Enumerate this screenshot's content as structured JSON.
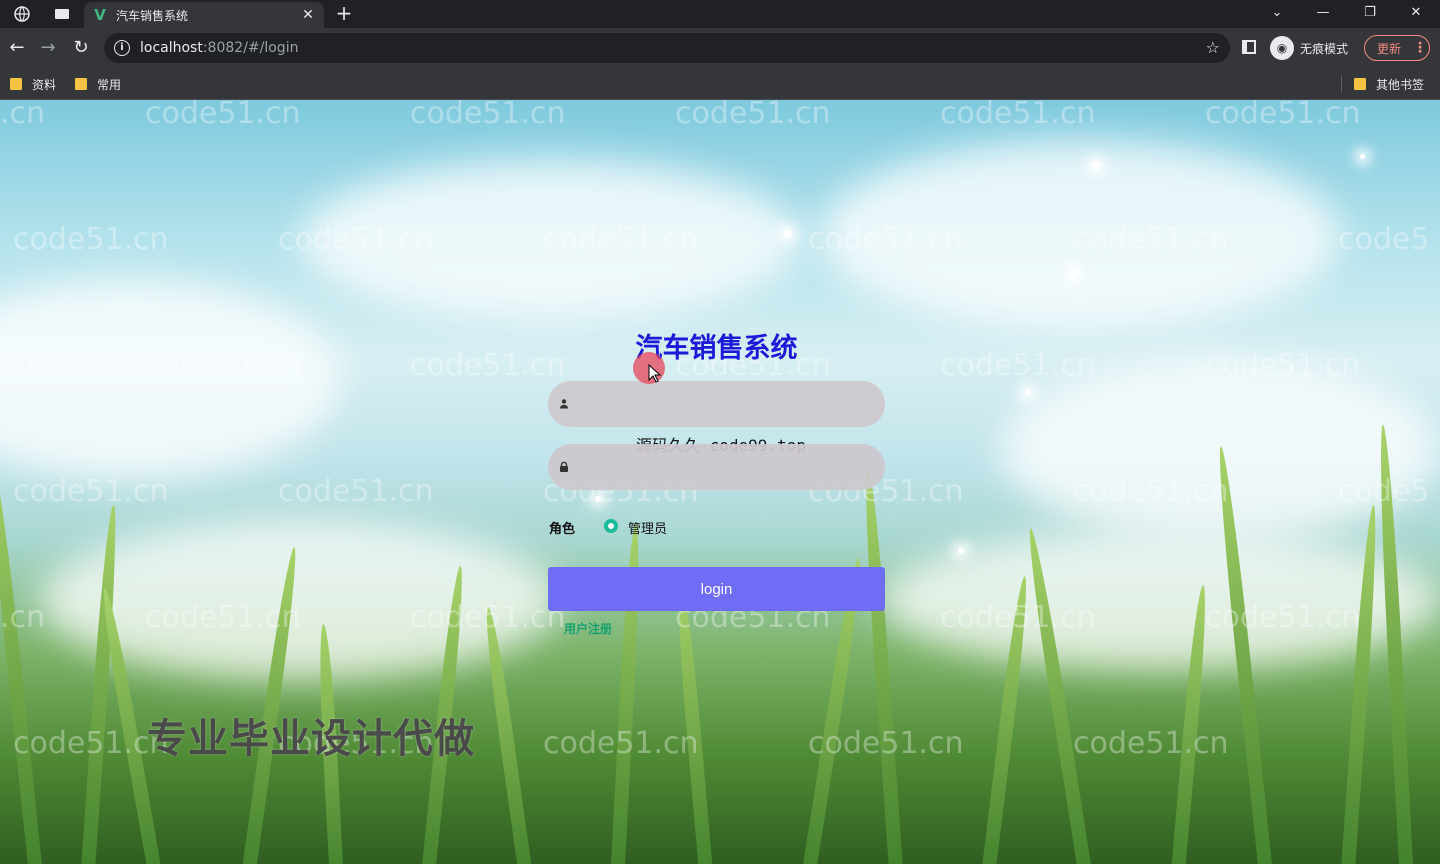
{
  "browser": {
    "tab_title": "汽车销售系统",
    "url_host": "localhost",
    "url_rest": ":8082/#/login",
    "incognito_label": "无痕模式",
    "update_label": "更新",
    "bookmarks": [
      "资料",
      "常用"
    ],
    "other_bookmarks": "其他书签"
  },
  "login": {
    "title": "汽车销售系统",
    "username_value": "",
    "password_value": "",
    "role_label": "角色",
    "role_option": "管理员",
    "login_button": "login",
    "register_link": "用户注册"
  },
  "overlay": {
    "source_watermark": "源码久久-code99.top",
    "promo_text": "专业毕业设计代做",
    "tiled_watermark": "code51.cn",
    "tiled_watermark_partial_left": ".cn",
    "tiled_watermark_partial_right": "code5"
  },
  "colors": {
    "title": "#1a1ad9",
    "login_button": "#6f6cf6",
    "register_link": "#15a06f",
    "radio_checked": "#1abc9c"
  }
}
